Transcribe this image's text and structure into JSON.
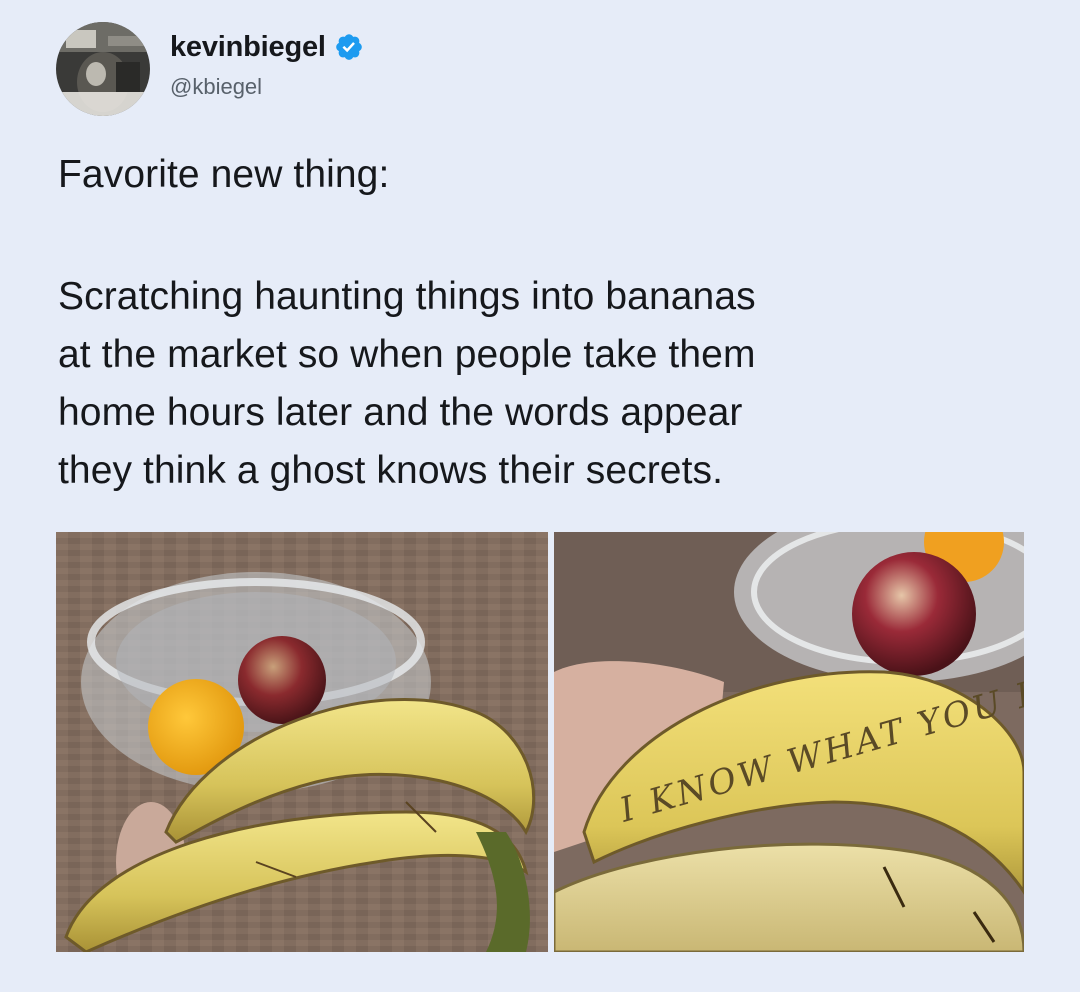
{
  "tweet": {
    "author": {
      "display_name": "kevinbiegel",
      "handle": "@kbiegel",
      "verified": true,
      "verified_icon": "verified-badge-icon",
      "verified_color": "#1d9bf0"
    },
    "text_first_line": "Favorite new thing:",
    "text_lines": [
      "Scratching haunting things into bananas",
      "at the market so when people take them",
      "home hours later and the words appear",
      "they think a ghost knows their secrets."
    ],
    "photos": {
      "right_scratched_text": "I KNOW WHAT YOU DID"
    }
  }
}
